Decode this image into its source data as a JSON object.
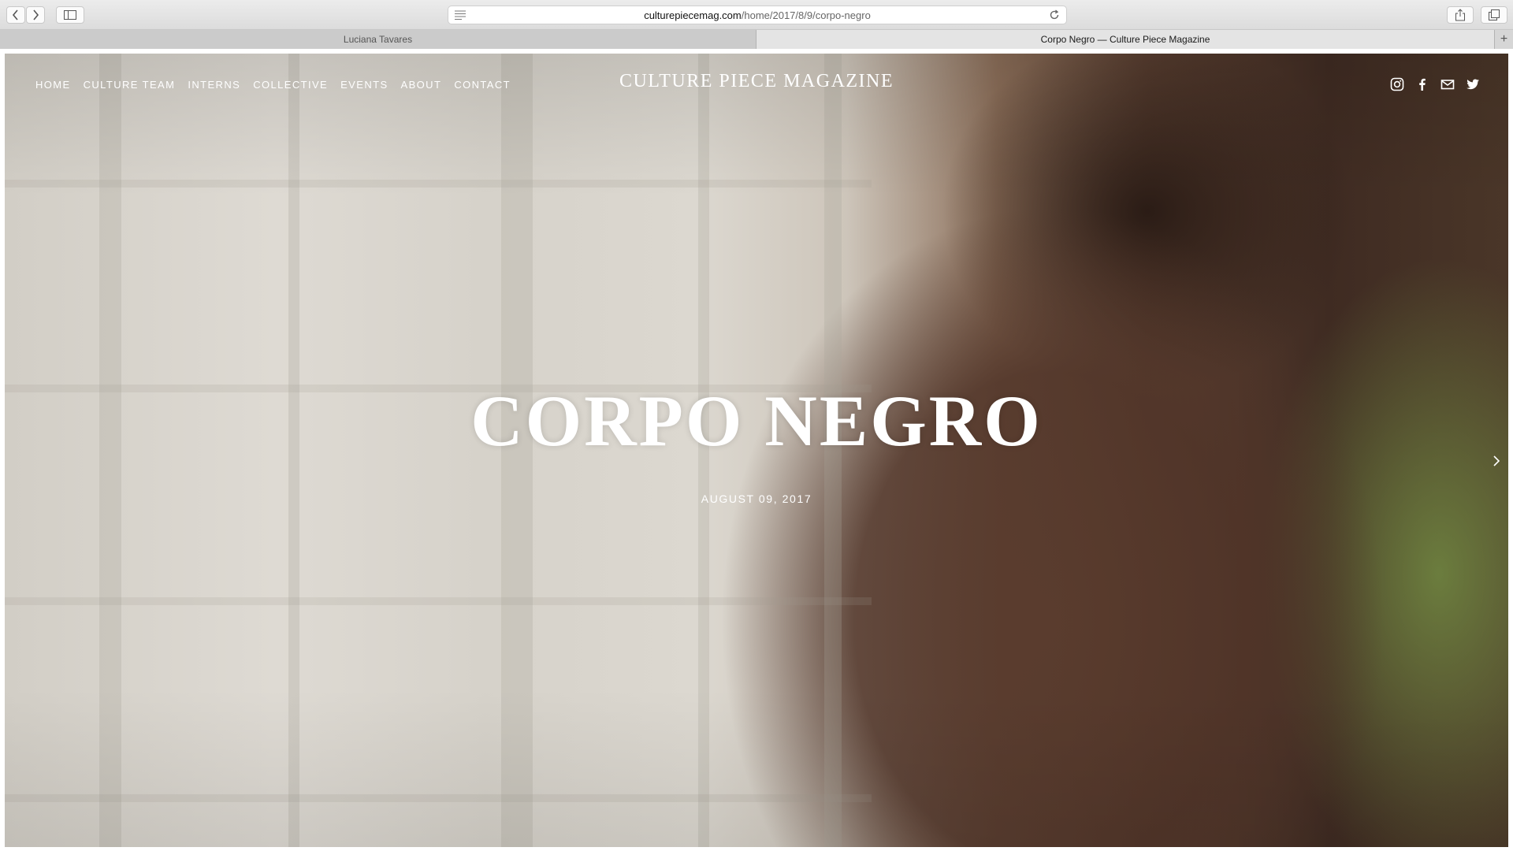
{
  "browser": {
    "url_domain": "culturepiecemag.com",
    "url_path": "/home/2017/8/9/corpo-negro"
  },
  "tabs": [
    {
      "label": "Luciana Tavares",
      "active": false
    },
    {
      "label": "Corpo Negro — Culture Piece Magazine",
      "active": true
    }
  ],
  "nav": {
    "items": [
      "HOME",
      "CULTURE TEAM",
      "INTERNS",
      "COLLECTIVE",
      "EVENTS",
      "ABOUT",
      "CONTACT"
    ]
  },
  "brand": "CULTURE PIECE MAGAZINE",
  "social_icons": [
    "instagram-icon",
    "facebook-icon",
    "mail-icon",
    "twitter-icon"
  ],
  "article": {
    "title": "CORPO NEGRO",
    "date": "AUGUST 09, 2017"
  },
  "colors": {
    "text_on_hero": "#ffffff"
  }
}
